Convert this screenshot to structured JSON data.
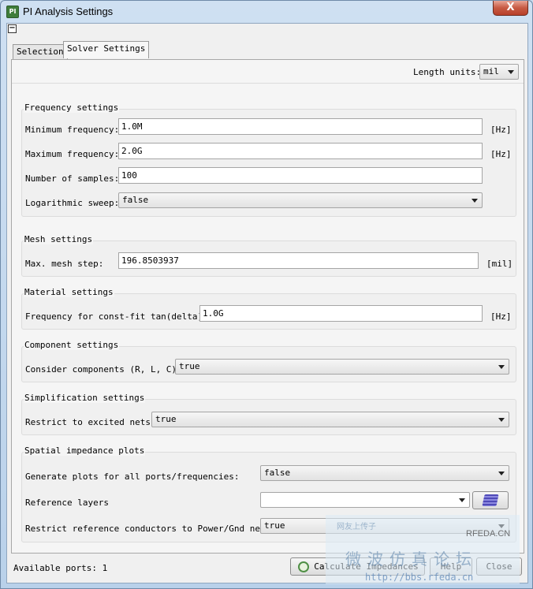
{
  "window": {
    "title": "PI Analysis Settings",
    "close": "X",
    "app_icon": "pi-icon"
  },
  "tabs": [
    {
      "label": "Selection"
    },
    {
      "label": "Solver Settings"
    }
  ],
  "length_units": {
    "label": "Length units:",
    "value": "mil"
  },
  "frequency": {
    "title": "Frequency settings",
    "min_label": "Minimum frequency:",
    "min_value": "1.0M",
    "min_unit": "[Hz]",
    "max_label": "Maximum frequency:",
    "max_value": "2.0G",
    "max_unit": "[Hz]",
    "samples_label": "Number of samples:",
    "samples_value": "100",
    "log_label": "Logarithmic sweep:",
    "log_value": "false"
  },
  "mesh": {
    "title": "Mesh settings",
    "label": "Max. mesh step:",
    "value": "196.8503937",
    "unit": "[mil]"
  },
  "material": {
    "title": "Material settings",
    "label": "Frequency for const-fit tan(delta):",
    "value": "1.0G",
    "unit": "[Hz]"
  },
  "component": {
    "title": "Component settings",
    "label": "Consider components (R, L, C):",
    "value": "true"
  },
  "simplification": {
    "title": "Simplification settings",
    "label": "Restrict to excited nets:",
    "value": "true"
  },
  "spatial": {
    "title": "Spatial impedance plots",
    "generate_label": "Generate plots for all ports/frequencies:",
    "generate_value": "false",
    "layers_label": "Reference layers",
    "layers_value": "",
    "restrict_label": "Restrict reference conductors to Power/Gnd nets:",
    "restrict_value": "true"
  },
  "footer": {
    "ports_text": "Available ports: 1",
    "calculate": "Calculate Impedances",
    "help": "Help",
    "close": "Close"
  },
  "watermark": {
    "small": "网友上传子",
    "logo": "RFEDA.CN",
    "cn": "微波仿真论坛",
    "url": "http://bbs.rfeda.cn"
  }
}
